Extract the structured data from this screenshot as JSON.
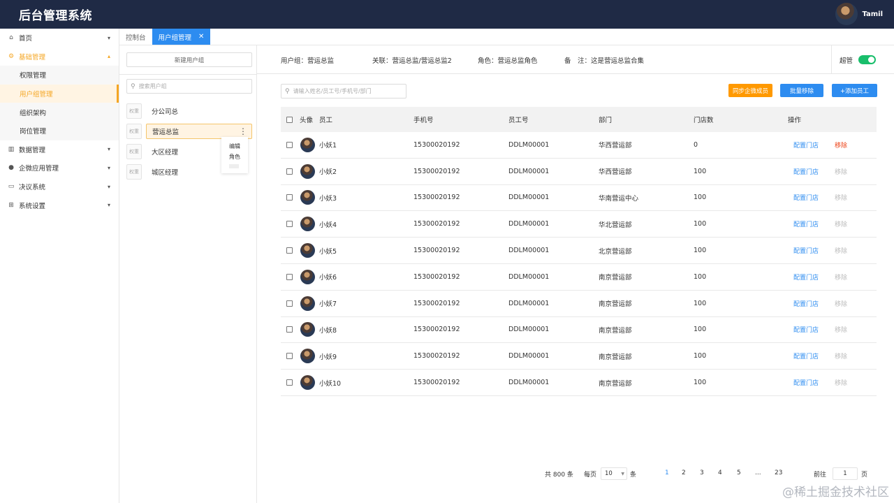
{
  "app": {
    "title": "后台管理系统",
    "user_name": "Tamil"
  },
  "sidebar": {
    "items": [
      {
        "label": "首页",
        "icon": "home-icon"
      },
      {
        "label": "基础管理",
        "icon": "gear-icon",
        "expanded": true,
        "children": [
          "权限管理",
          "用户组管理",
          "组织架构",
          "岗位管理"
        ],
        "active_child": "用户组管理"
      },
      {
        "label": "数据管理",
        "icon": "chart-icon"
      },
      {
        "label": "企微应用管理",
        "icon": "chat-icon"
      },
      {
        "label": "决议系统",
        "icon": "board-icon"
      },
      {
        "label": "系统设置",
        "icon": "grid-icon"
      }
    ]
  },
  "tabs": [
    {
      "label": "控制台"
    },
    {
      "label": "用户组管理",
      "active": true
    }
  ],
  "group_panel": {
    "new_group_label": "新建用户组",
    "search_placeholder": "搜索用户组",
    "perm_label": "权重",
    "groups": [
      "分公司总",
      "营运总监",
      "大区经理",
      "城区经理"
    ],
    "active_group": "营运总监",
    "context_menu": [
      "编辑",
      "角色"
    ]
  },
  "info": {
    "group_key": "用户组：",
    "group_val": "营运总监",
    "assoc_key": "关联：",
    "assoc_val": "营运总监/营运总监2",
    "role_key": "角色：",
    "role_val": "营运总监角色",
    "remark_key": "备　注：",
    "remark_val": "这是营运总监合集",
    "superadmin_label": "超管",
    "superadmin_on": true
  },
  "toolbar": {
    "search_placeholder": "请输入姓名/员工号/手机号/部门",
    "sync_label": "同步企微成员",
    "batch_remove_label": "批量移除",
    "add_label": "+添加员工"
  },
  "table": {
    "headers": {
      "avatar": "头像",
      "employee": "员工",
      "phone": "手机号",
      "emp_no": "员工号",
      "dept": "部门",
      "stores": "门店数",
      "ops": "操作"
    },
    "config_label": "配置门店",
    "remove_label": "移除",
    "rows": [
      {
        "name": "小妖1",
        "phone": "15300020192",
        "emp_no": "DDLM00001",
        "dept": "华西营运部",
        "stores": "0",
        "remove_active": true
      },
      {
        "name": "小妖2",
        "phone": "15300020192",
        "emp_no": "DDLM00001",
        "dept": "华西营运部",
        "stores": "100"
      },
      {
        "name": "小妖3",
        "phone": "15300020192",
        "emp_no": "DDLM00001",
        "dept": "华南营运中心",
        "stores": "100"
      },
      {
        "name": "小妖4",
        "phone": "15300020192",
        "emp_no": "DDLM00001",
        "dept": "华北营运部",
        "stores": "100"
      },
      {
        "name": "小妖5",
        "phone": "15300020192",
        "emp_no": "DDLM00001",
        "dept": "北京营运部",
        "stores": "100"
      },
      {
        "name": "小妖6",
        "phone": "15300020192",
        "emp_no": "DDLM00001",
        "dept": "南京营运部",
        "stores": "100"
      },
      {
        "name": "小妖7",
        "phone": "15300020192",
        "emp_no": "DDLM00001",
        "dept": "南京营运部",
        "stores": "100"
      },
      {
        "name": "小妖8",
        "phone": "15300020192",
        "emp_no": "DDLM00001",
        "dept": "南京营运部",
        "stores": "100"
      },
      {
        "name": "小妖9",
        "phone": "15300020192",
        "emp_no": "DDLM00001",
        "dept": "南京营运部",
        "stores": "100"
      },
      {
        "name": "小妖10",
        "phone": "15300020192",
        "emp_no": "DDLM00001",
        "dept": "南京营运部",
        "stores": "100"
      }
    ]
  },
  "pagination": {
    "total_text": "共 800 条",
    "page_size_label": "每页",
    "page_size": "10",
    "page_size_unit": "条",
    "pages": [
      "1",
      "2",
      "3",
      "4",
      "5",
      "...",
      "23"
    ],
    "current": "1",
    "jump_label": "前往",
    "jump_value": "1",
    "jump_unit": "页"
  },
  "watermark": "@稀土掘金技术社区",
  "colors": {
    "header_bg": "#1f2a45",
    "accent_orange": "#f5a623",
    "primary_blue": "#2d8cf0",
    "switch_green": "#19be6b",
    "danger_red": "#ed4014"
  }
}
